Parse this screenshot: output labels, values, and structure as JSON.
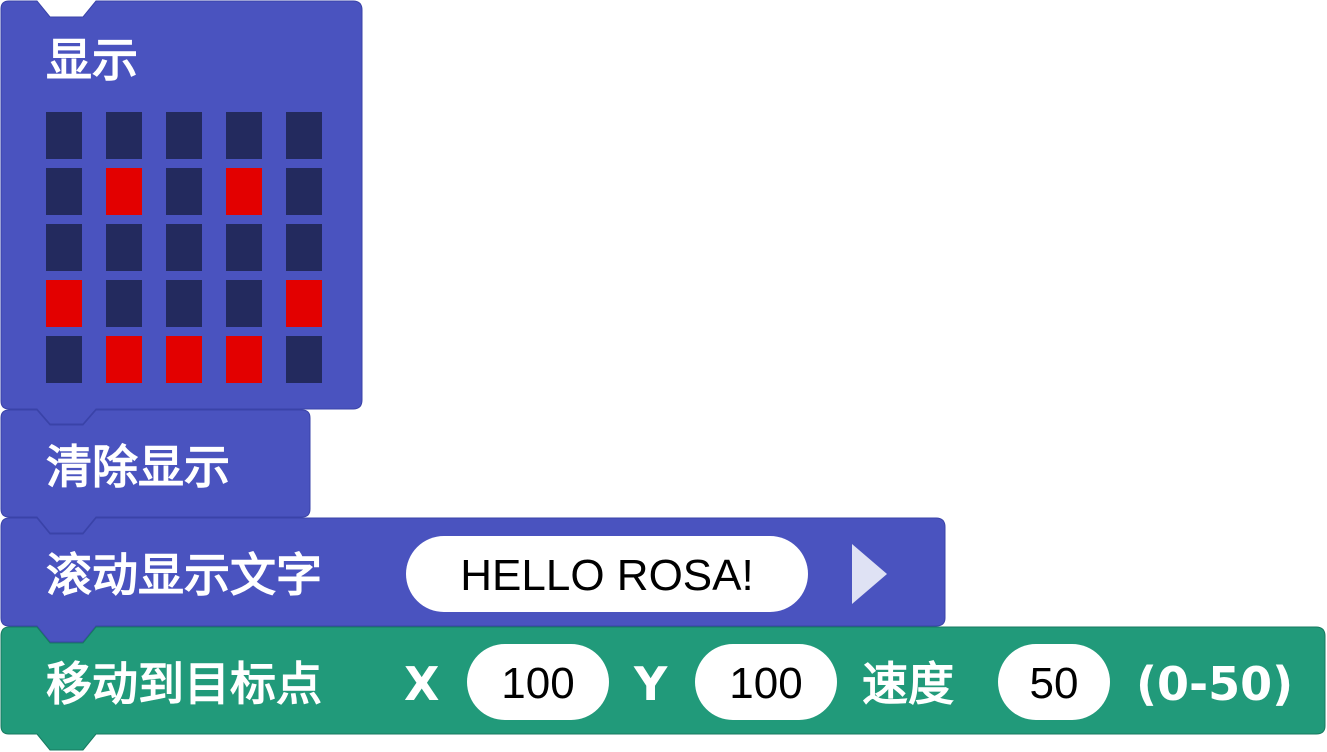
{
  "colors": {
    "display_block": "#4a53bf",
    "display_block_stroke": "#3a43a8",
    "motion_block": "#219a7a",
    "motion_block_stroke": "#177a60",
    "led_off": "#232a5e",
    "led_on": "#e30000",
    "field_bg": "#ffffff",
    "arrow": "#dfe2f4"
  },
  "show_block": {
    "label": "显示",
    "leds": [
      [
        0,
        0,
        0,
        0,
        0
      ],
      [
        0,
        1,
        0,
        1,
        0
      ],
      [
        0,
        0,
        0,
        0,
        0
      ],
      [
        1,
        0,
        0,
        0,
        1
      ],
      [
        0,
        1,
        1,
        1,
        0
      ]
    ]
  },
  "clear_block": {
    "label": "清除显示"
  },
  "scroll_block": {
    "label": "滚动显示文字",
    "text_value": "HELLO ROSA!",
    "expand_icon": "triangle-right-icon"
  },
  "move_block": {
    "label": "移动到目标点",
    "x_label": "X",
    "x_value": "100",
    "y_label": "Y",
    "y_value": "100",
    "speed_label": "速度",
    "speed_value": "50",
    "range_label": "(0-50)"
  }
}
